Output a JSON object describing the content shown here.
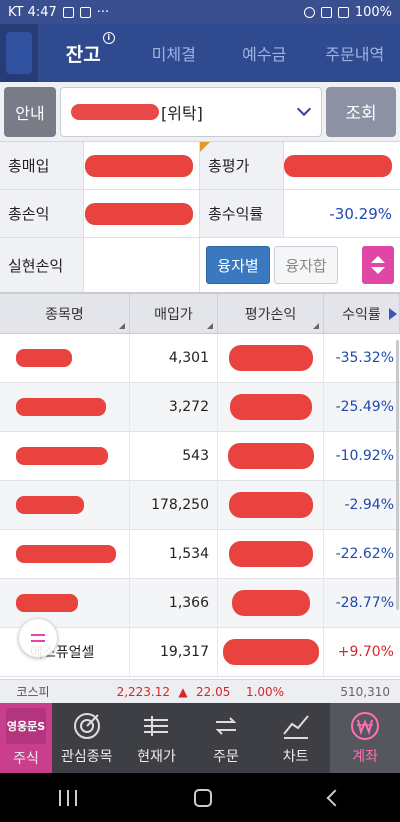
{
  "status_bar": {
    "carrier_time": "KT 4:47",
    "more": "···",
    "battery": "100%"
  },
  "tabs": [
    {
      "label": "잔고",
      "active": true
    },
    {
      "label": "미체결",
      "active": false
    },
    {
      "label": "예수금",
      "active": false
    },
    {
      "label": "주문내역",
      "active": false
    }
  ],
  "account": {
    "guide_label": "안내",
    "account_type": "[위탁]",
    "query_label": "조회"
  },
  "summary": {
    "total_buy_label": "총매입",
    "total_eval_label": "총평가",
    "total_pl_label": "총손익",
    "total_return_label": "총수익률",
    "total_return_value": "-30.29%",
    "realized_pl_label": "실현손익",
    "seg_by_loan": "융자별",
    "seg_sum_loan": "융자합"
  },
  "table": {
    "headers": [
      "종목명",
      "매입가",
      "평가손익",
      "수익률"
    ],
    "rows": [
      {
        "name": "",
        "buy_price": "4,301",
        "return": "-35.32%",
        "sign": "neg"
      },
      {
        "name": "",
        "buy_price": "3,272",
        "return": "-25.49%",
        "sign": "neg"
      },
      {
        "name": "",
        "buy_price": "543",
        "return": "-10.92%",
        "sign": "neg"
      },
      {
        "name": "",
        "buy_price": "178,250",
        "return": "-2.94%",
        "sign": "neg"
      },
      {
        "name": "",
        "buy_price": "1,534",
        "return": "-22.62%",
        "sign": "neg"
      },
      {
        "name": "",
        "buy_price": "1,366",
        "return": "-28.77%",
        "sign": "neg"
      },
      {
        "name": "에스퓨얼셀",
        "buy_price": "19,317",
        "return": "+9.70%",
        "sign": "pos"
      }
    ]
  },
  "ticker": {
    "name": "코스피",
    "value": "2,223.12",
    "arrow": "▲",
    "change": "22.05",
    "percent": "1.00%",
    "volume": "510,310"
  },
  "bottom_nav": [
    {
      "label": "주식",
      "icon": "brand-logo-icon"
    },
    {
      "label": "관심종목",
      "icon": "target-icon"
    },
    {
      "label": "현재가",
      "icon": "price-list-icon"
    },
    {
      "label": "주문",
      "icon": "exchange-arrows-icon"
    },
    {
      "label": "차트",
      "icon": "chart-icon"
    },
    {
      "label": "계좌",
      "icon": "won-icon",
      "active": true
    }
  ],
  "brand_logo_text": "영웅문S",
  "colors": {
    "header": "#2f4a8e",
    "negative": "#1f4ab0",
    "positive": "#d8262a",
    "accent": "#e046a5"
  }
}
